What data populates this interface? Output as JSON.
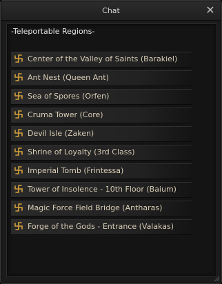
{
  "window": {
    "title": "Chat",
    "close_label": "✕"
  },
  "dialog": {
    "header": "-Teleportable Regions-",
    "items": [
      {
        "label": "Center of the Valley of Saints (Barakiel)"
      },
      {
        "label": "Ant Nest (Queen Ant)"
      },
      {
        "label": "Sea of Spores (Orfen)"
      },
      {
        "label": "Cruma Tower (Core)"
      },
      {
        "label": "Devil Isle (Zaken)"
      },
      {
        "label": "Shrine of Loyalty (3rd Class)"
      },
      {
        "label": "Imperial Tomb (Frintessa)"
      },
      {
        "label": "Tower of Insolence - 10th Floor (Baium)"
      },
      {
        "label": "Magic Force Field Bridge (Antharas)"
      },
      {
        "label": "Forge of the Gods - Entrance (Valakas)"
      }
    ]
  },
  "colors": {
    "accent": "#d6a33a",
    "text": "#d8cdb6"
  }
}
